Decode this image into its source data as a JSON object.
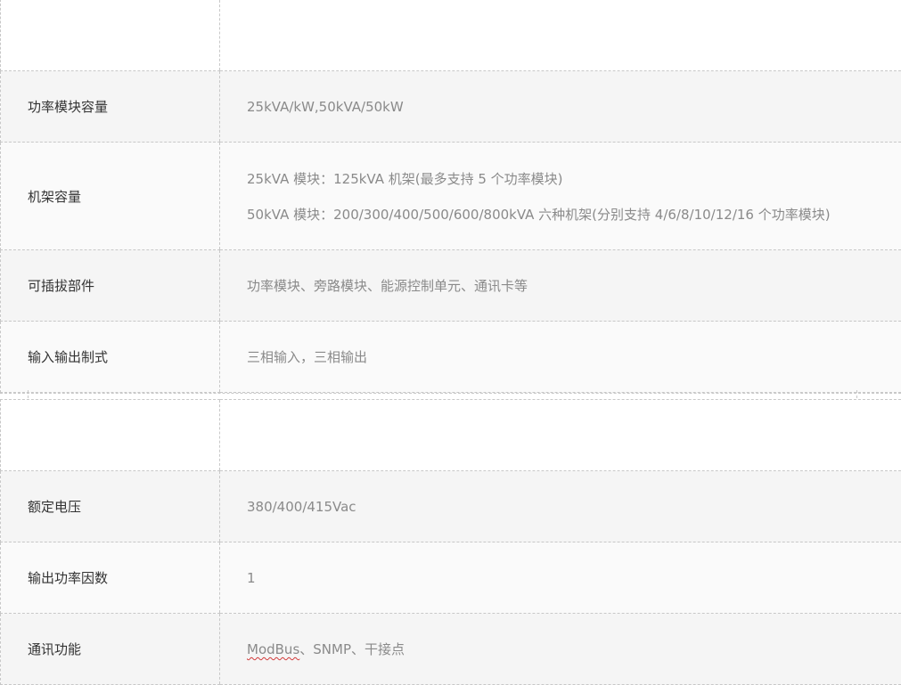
{
  "table_1": {
    "rows": [
      {
        "label": "",
        "value": ""
      },
      {
        "label": "功率模块容量",
        "value": "25kVA/kW,50kVA/50kW"
      },
      {
        "label": "机架容量",
        "value_lines": [
          "25kVA 模块：125kVA 机架(最多支持 5 个功率模块)",
          "50kVA 模块：200/300/400/500/600/800kVA 六种机架(分别支持 4/6/8/10/12/16 个功率模块)"
        ]
      },
      {
        "label": "可插拔部件",
        "value": "功率模块、旁路模块、能源控制单元、通讯卡等"
      },
      {
        "label": "输入输出制式",
        "value": "三相输入，三相输出"
      }
    ]
  },
  "table_2": {
    "rows": [
      {
        "label": "",
        "value": ""
      },
      {
        "label": "额定电压",
        "value": "380/400/415Vac"
      },
      {
        "label": "输出功率因数",
        "value": "1"
      },
      {
        "label": "通讯功能",
        "value_parts": [
          "ModBus",
          "、SNMP、干接点"
        ]
      }
    ]
  }
}
